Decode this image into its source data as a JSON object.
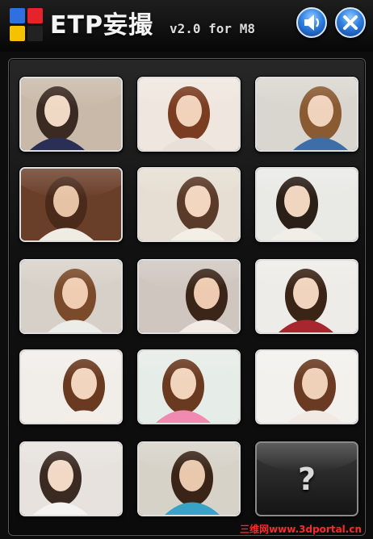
{
  "app": {
    "title": "ETP妄撮",
    "version": "v2.0 for M8"
  },
  "header_buttons": [
    {
      "name": "sound",
      "icon": "speaker-icon"
    },
    {
      "name": "close",
      "icon": "close-icon"
    }
  ],
  "gallery": {
    "tiles": [
      {
        "icon": "photo-icon",
        "kind": "photo"
      },
      {
        "icon": "photo-icon",
        "kind": "photo"
      },
      {
        "icon": "photo-icon",
        "kind": "photo"
      },
      {
        "icon": "photo-icon",
        "kind": "photo"
      },
      {
        "icon": "photo-icon",
        "kind": "photo"
      },
      {
        "icon": "photo-icon",
        "kind": "photo"
      },
      {
        "icon": "photo-icon",
        "kind": "photo"
      },
      {
        "icon": "photo-icon",
        "kind": "photo"
      },
      {
        "icon": "photo-icon",
        "kind": "photo"
      },
      {
        "icon": "photo-icon",
        "kind": "photo"
      },
      {
        "icon": "photo-icon",
        "kind": "photo"
      },
      {
        "icon": "photo-icon",
        "kind": "photo"
      },
      {
        "icon": "photo-icon",
        "kind": "photo"
      },
      {
        "icon": "photo-icon",
        "kind": "photo"
      },
      {
        "icon": "question-mark-icon",
        "kind": "locked",
        "label": "?"
      }
    ]
  },
  "watermark": "三维网www.3dportal.cn"
}
